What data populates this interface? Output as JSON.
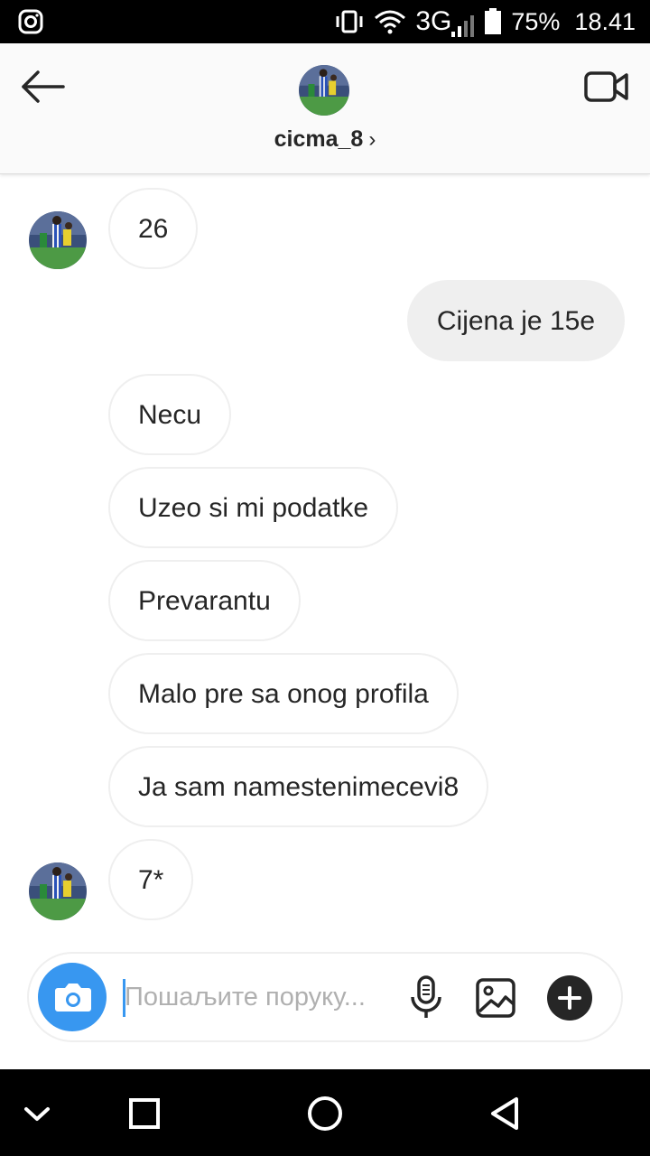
{
  "status_bar": {
    "network": "3G",
    "battery": "75%",
    "time": "18.41",
    "icons": [
      "instagram-icon",
      "vibrate-icon",
      "wifi-icon",
      "signal-icon",
      "battery-icon"
    ]
  },
  "header": {
    "username": "cicma_8",
    "chevron": "›",
    "icons": [
      "back-arrow-icon",
      "video-call-icon"
    ]
  },
  "messages": [
    {
      "side": "in",
      "text": "26",
      "avatar": true
    },
    {
      "side": "out",
      "text": "Cijena je 15e"
    },
    {
      "side": "in",
      "text": "Necu"
    },
    {
      "side": "in",
      "text": "Uzeo si mi podatke"
    },
    {
      "side": "in",
      "text": "Prevarantu"
    },
    {
      "side": "in",
      "text": "Malo pre sa onog profila"
    },
    {
      "side": "in",
      "text": "Ja sam namestenimecevi8"
    },
    {
      "side": "in",
      "text": "7*",
      "avatar": true
    }
  ],
  "composer": {
    "placeholder": "Пошаљите поруку...",
    "value": "",
    "icons": [
      "camera-icon",
      "microphone-icon",
      "gallery-icon",
      "plus-icon"
    ],
    "accent": "#3897f0"
  },
  "nav_bar": {
    "icons": [
      "chevron-down-icon",
      "recents-square-icon",
      "home-circle-icon",
      "back-triangle-icon"
    ]
  }
}
